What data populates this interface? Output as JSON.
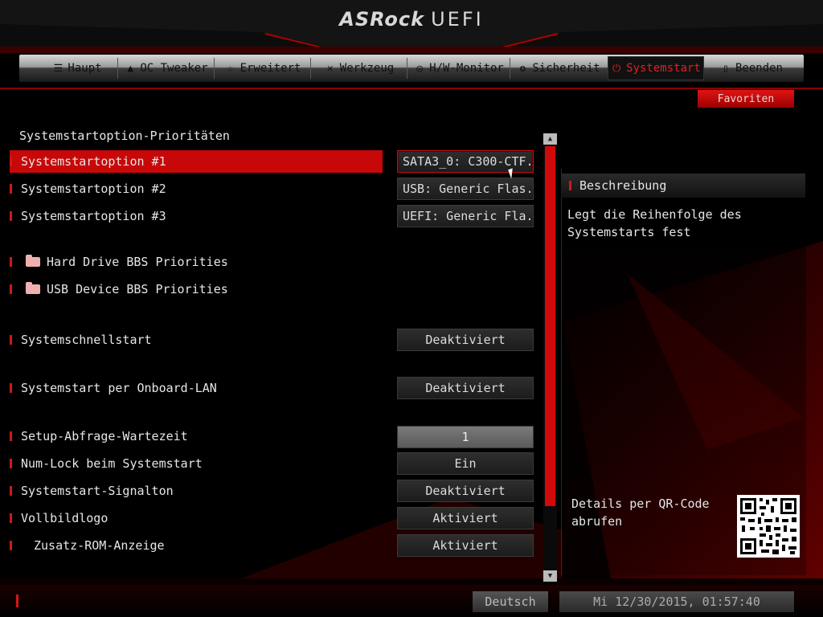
{
  "header": {
    "brand": "ASRock",
    "product": "UEFI"
  },
  "tabs": [
    {
      "label": "Haupt",
      "icon": "list-icon",
      "active": false
    },
    {
      "label": "OC Tweaker",
      "icon": "rocket-icon",
      "active": false
    },
    {
      "label": "Erweitert",
      "icon": "star-icon",
      "active": false
    },
    {
      "label": "Werkzeug",
      "icon": "tools-icon",
      "active": false
    },
    {
      "label": "H/W-Monitor",
      "icon": "gauge-icon",
      "active": false
    },
    {
      "label": "Sicherheit",
      "icon": "shield-icon",
      "active": false
    },
    {
      "label": "Systemstart",
      "icon": "power-icon",
      "active": true
    },
    {
      "label": "Beenden",
      "icon": "exit-door-icon",
      "active": false
    }
  ],
  "favorites_label": "Favoriten",
  "section_title": "Systemstartoption-Prioritäten",
  "settings": [
    {
      "label": "Systemstartoption #1",
      "value": "SATA3_0: C300-CTF...",
      "selected": true
    },
    {
      "label": "Systemstartoption #2",
      "value": "USB: Generic Flas..."
    },
    {
      "label": "Systemstartoption #3",
      "value": "UEFI: Generic Fla..."
    },
    {
      "label": "Hard Drive BBS Priorities",
      "folder": true
    },
    {
      "label": "USB Device BBS Priorities",
      "folder": true
    },
    {
      "label": "Systemschnellstart",
      "value": "Deaktiviert"
    },
    {
      "label": "Systemstart per Onboard-LAN",
      "value": "Deaktiviert"
    },
    {
      "label": "Setup-Abfrage-Wartezeit",
      "value": "1"
    },
    {
      "label": "Num-Lock beim Systemstart",
      "value": "Ein"
    },
    {
      "label": "Systemstart-Signalton",
      "value": "Deaktiviert"
    },
    {
      "label": "Vollbildlogo",
      "value": "Aktiviert"
    },
    {
      "label": "Zusatz-ROM-Anzeige",
      "value": "Aktiviert"
    }
  ],
  "description": {
    "title": "Beschreibung",
    "text": "Legt die Reihenfolge des Systemstarts fest",
    "qr_text": "Details per QR-Code abrufen"
  },
  "footer": {
    "language": "Deutsch",
    "datetime": "Mi 12/30/2015, 01:57:40"
  },
  "colors": {
    "accent": "#d00a0a",
    "background": "#000000",
    "text": "#e6e6e6"
  }
}
